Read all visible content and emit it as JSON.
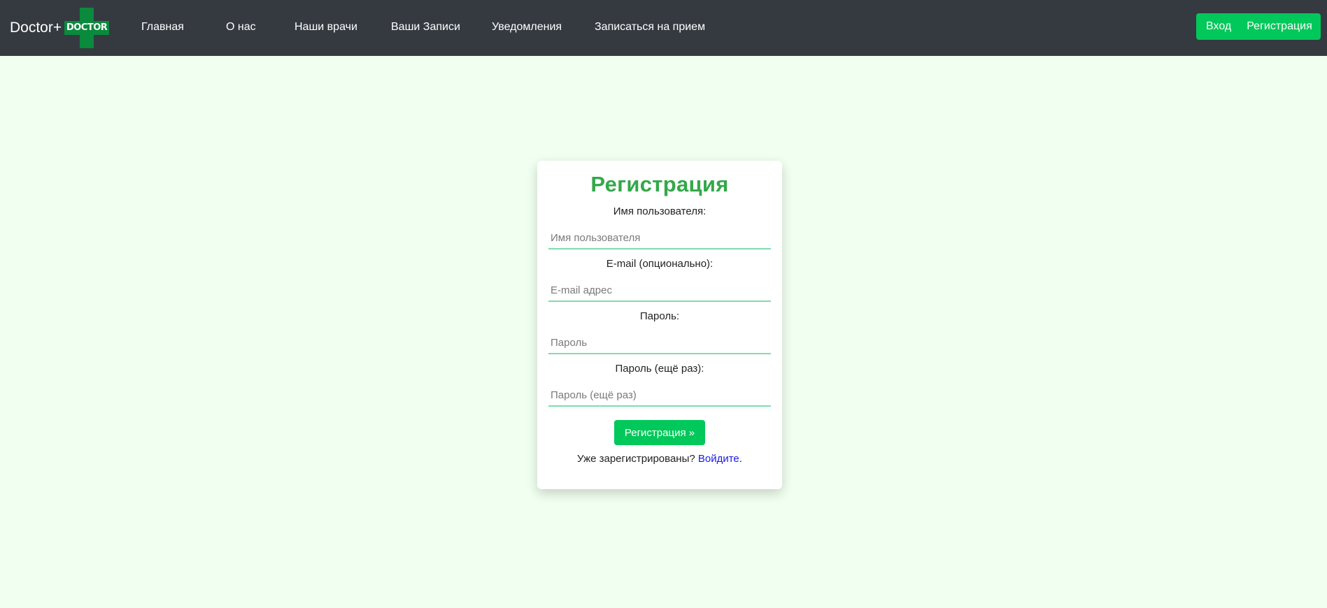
{
  "navbar": {
    "brand_text": "Doctor+",
    "logo_text": "DOCTOR",
    "links": [
      {
        "label": "Главная"
      },
      {
        "label": "О нас"
      },
      {
        "label": "Наши врачи"
      },
      {
        "label": "Ваши Записи"
      },
      {
        "label": "Уведомления"
      },
      {
        "label": "Записаться на прием"
      }
    ],
    "login_label": "Вход",
    "register_label": "Регистрация"
  },
  "form": {
    "title": "Регистрация",
    "username": {
      "label": "Имя пользователя:",
      "placeholder": "Имя пользователя",
      "value": ""
    },
    "email": {
      "label": "E-mail (опционально):",
      "placeholder": "E-mail адрес",
      "value": ""
    },
    "password": {
      "label": "Пароль:",
      "placeholder": "Пароль",
      "value": ""
    },
    "password2": {
      "label": "Пароль (ещё раз):",
      "placeholder": "Пароль (ещё раз)",
      "value": ""
    },
    "submit_label": "Регистрация »",
    "already_text": "Уже зарегистрированы?",
    "login_link": "Войдите",
    "period": "."
  },
  "colors": {
    "navbar_bg": "#343a40",
    "page_bg": "#f0fff0",
    "accent_green": "#00c85a",
    "title_green": "#33a84a",
    "input_underline": "#7fdcae",
    "link_blue": "#1a1ae6",
    "logo_green": "#0a8a3c"
  }
}
